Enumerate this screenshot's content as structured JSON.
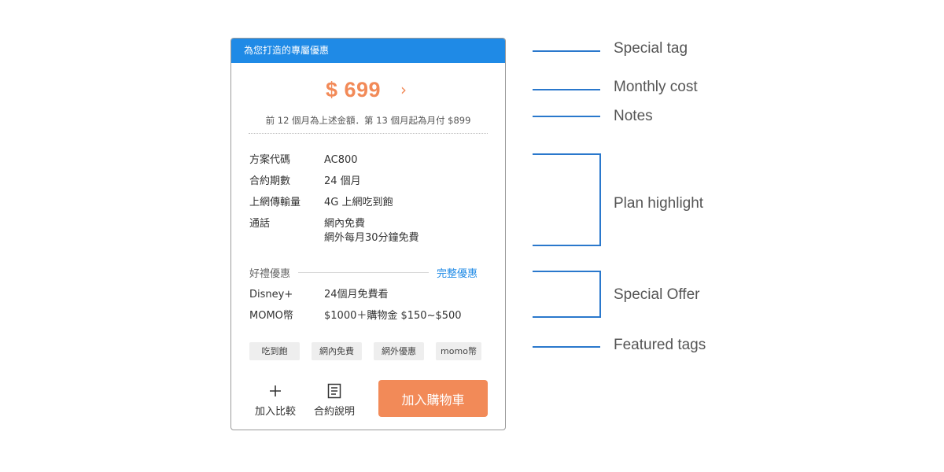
{
  "card": {
    "header": "為您打造的專屬優惠",
    "price": "$ 699",
    "notes": "前 12 個月為上述金額．第 13 個月起為月付 $899",
    "plan_rows": [
      {
        "label": "方案代碼",
        "value": "AC800",
        "value2": ""
      },
      {
        "label": "合約期數",
        "value": "24 個月",
        "value2": ""
      },
      {
        "label": "上網傳輸量",
        "value": "4G 上網吃到飽",
        "value2": ""
      },
      {
        "label": "通話",
        "value": "網內免費",
        "value2": "網外每月30分鐘免費"
      }
    ],
    "offer_title": "好禮優惠",
    "offer_link": "完整優惠",
    "offers": [
      {
        "label": "Disney+",
        "value": "24個月免費看"
      },
      {
        "label": "MOMO幣",
        "value": "$1000＋購物金 $150~$500"
      }
    ],
    "tags": [
      "吃到飽",
      "網內免費",
      "網外優惠",
      "momo幣"
    ],
    "compare_label": "加入比較",
    "contract_label": "合約說明",
    "cart_label": "加入購物車"
  },
  "annotations": {
    "special_tag": "Special tag",
    "monthly_cost": "Monthly cost",
    "notes": "Notes",
    "plan_highlight": "Plan highlight",
    "special_offer": "Special Offer",
    "featured_tags": "Featured tags"
  },
  "colors": {
    "header_blue": "#1f8ae6",
    "accent_orange": "#f28a58",
    "annotation_blue": "#2a78cc"
  },
  "icons": {
    "chevron": "chevron-right-icon",
    "compare": "plus-icon",
    "contract": "document-icon"
  }
}
